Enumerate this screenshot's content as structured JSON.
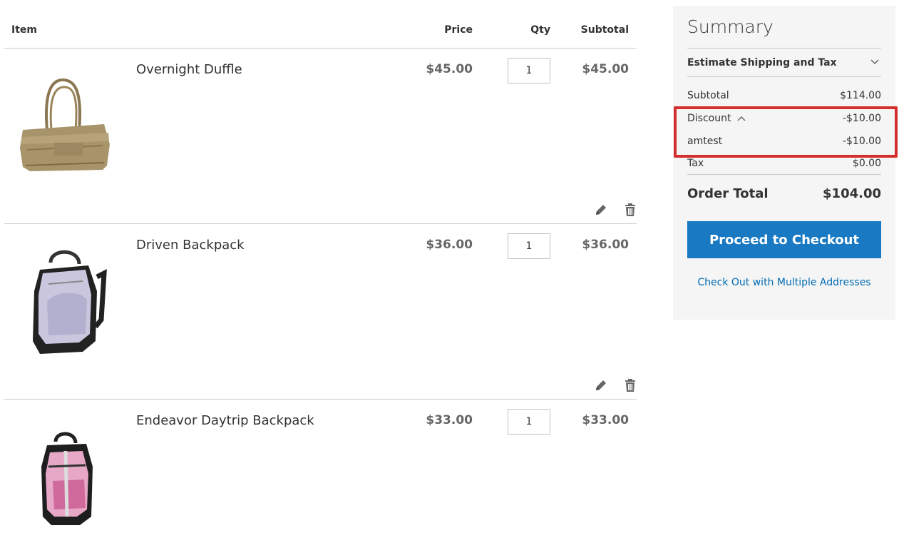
{
  "table": {
    "headers": {
      "item": "Item",
      "price": "Price",
      "qty": "Qty",
      "subtotal": "Subtotal"
    },
    "rows": [
      {
        "name": "Overnight Duffle",
        "price": "$45.00",
        "qty": "1",
        "subtotal": "$45.00"
      },
      {
        "name": "Driven Backpack",
        "price": "$36.00",
        "qty": "1",
        "subtotal": "$36.00"
      },
      {
        "name": "Endeavor Daytrip Backpack",
        "price": "$33.00",
        "qty": "1",
        "subtotal": "$33.00"
      }
    ],
    "icons": {
      "edit": "pencil-icon",
      "delete": "trash-icon"
    }
  },
  "summary": {
    "title": "Summary",
    "estimate_label": "Estimate Shipping and Tax",
    "subtotal_label": "Subtotal",
    "subtotal_value": "$114.00",
    "discount_label": "Discount",
    "discount_value": "-$10.00",
    "coupon_label": "amtest",
    "coupon_value": "-$10.00",
    "tax_label": "Tax",
    "tax_value": "$0.00",
    "total_label": "Order Total",
    "total_value": "$104.00",
    "checkout_label": "Proceed to Checkout",
    "multi_label": "Check Out with Multiple Addresses"
  },
  "colors": {
    "accent": "#1979c3",
    "link": "#006bb4",
    "highlight": "#d32f2f",
    "summary_bg": "#f5f5f5"
  }
}
